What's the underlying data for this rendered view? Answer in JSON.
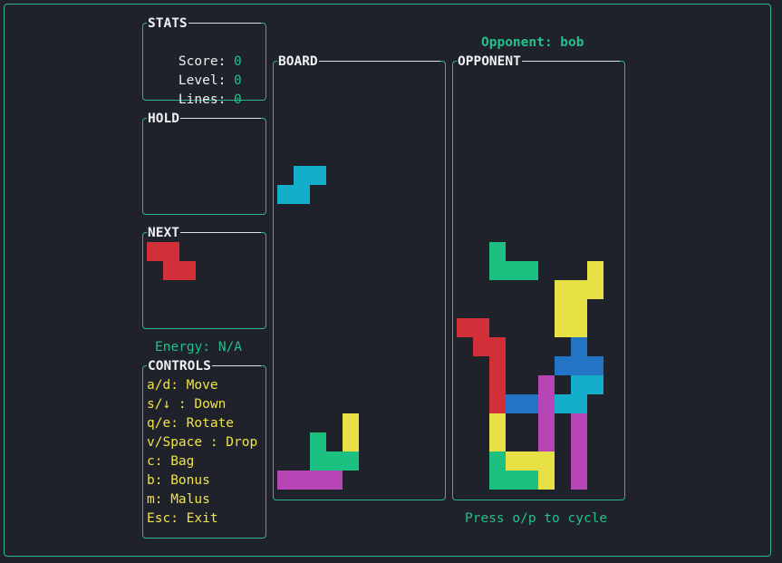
{
  "colors": {
    "border": "#2fb586",
    "background": "#1f222b",
    "cyan": "#13aec9",
    "green": "#1cc080",
    "yellow": "#e8e145",
    "red": "#d23038",
    "blue": "#2474c6",
    "purple": "#b845b5"
  },
  "stats": {
    "title": "STATS",
    "score_label": "Score:",
    "score": "0",
    "level_label": "Level:",
    "level": "0",
    "lines_label": "Lines:",
    "lines": "0"
  },
  "hold": {
    "title": "HOLD"
  },
  "next": {
    "title": "NEXT",
    "piece": "Z"
  },
  "energy": "Energy: N/A",
  "controls": {
    "title": "CONTROLS",
    "items": [
      "a/d: Move",
      "s/↓ : Down",
      "q/e: Rotate",
      "v/Space : Drop",
      "c: Bag",
      "b: Bonus",
      "m: Malus",
      "Esc: Exit"
    ]
  },
  "board": {
    "title": "BOARD",
    "active_piece": "S"
  },
  "opponent": {
    "header": "Opponent: bob",
    "title": "OPPONENT",
    "cycle_hint": "Press o/p to cycle"
  }
}
